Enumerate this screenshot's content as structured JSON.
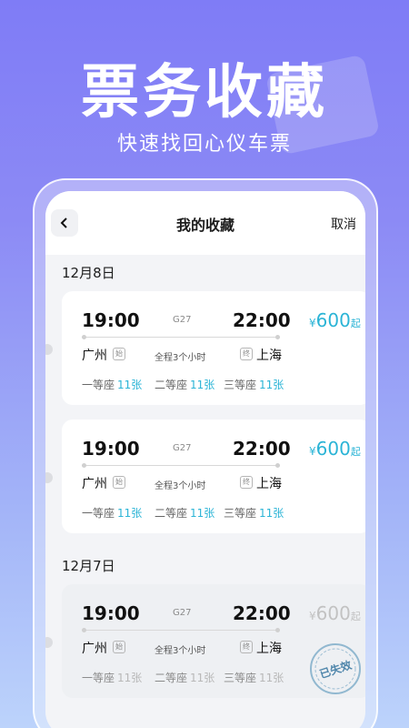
{
  "hero": {
    "title": "票务收藏",
    "subtitle": "快速找回心仪车票"
  },
  "nav": {
    "title": "我的收藏",
    "cancel_label": "取消"
  },
  "groups": [
    {
      "date": "12月8日",
      "tickets": [
        {
          "depart_time": "19:00",
          "arrive_time": "22:00",
          "train_no": "G27",
          "from": "广州",
          "to": "上海",
          "from_tag": "始",
          "to_tag": "终",
          "duration": "全程3个小时",
          "price_symbol": "¥",
          "price": "600",
          "price_suffix": "起",
          "seats": [
            {
              "name": "一等座",
              "count": "11张"
            },
            {
              "name": "二等座",
              "count": "11张"
            },
            {
              "name": "三等座",
              "count": "11张"
            }
          ]
        },
        {
          "depart_time": "19:00",
          "arrive_time": "22:00",
          "train_no": "G27",
          "from": "广州",
          "to": "上海",
          "from_tag": "始",
          "to_tag": "终",
          "duration": "全程3个小时",
          "price_symbol": "¥",
          "price": "600",
          "price_suffix": "起",
          "seats": [
            {
              "name": "一等座",
              "count": "11张"
            },
            {
              "name": "二等座",
              "count": "11张"
            },
            {
              "name": "三等座",
              "count": "11张"
            }
          ]
        }
      ]
    },
    {
      "date": "12月7日",
      "tickets": [
        {
          "depart_time": "19:00",
          "arrive_time": "22:00",
          "train_no": "G27",
          "from": "广州",
          "to": "上海",
          "from_tag": "始",
          "to_tag": "终",
          "duration": "全程3个小时",
          "price_symbol": "¥",
          "price": "600",
          "price_suffix": "起",
          "expired_stamp": "已失效",
          "seats": [
            {
              "name": "一等座",
              "count": "11张"
            },
            {
              "name": "二等座",
              "count": "11张"
            },
            {
              "name": "三等座",
              "count": "11张"
            }
          ]
        }
      ]
    }
  ],
  "colors": {
    "accent": "#2bb4d6",
    "background_top": "#7f7cf6",
    "background_bottom": "#bcd3fb"
  }
}
